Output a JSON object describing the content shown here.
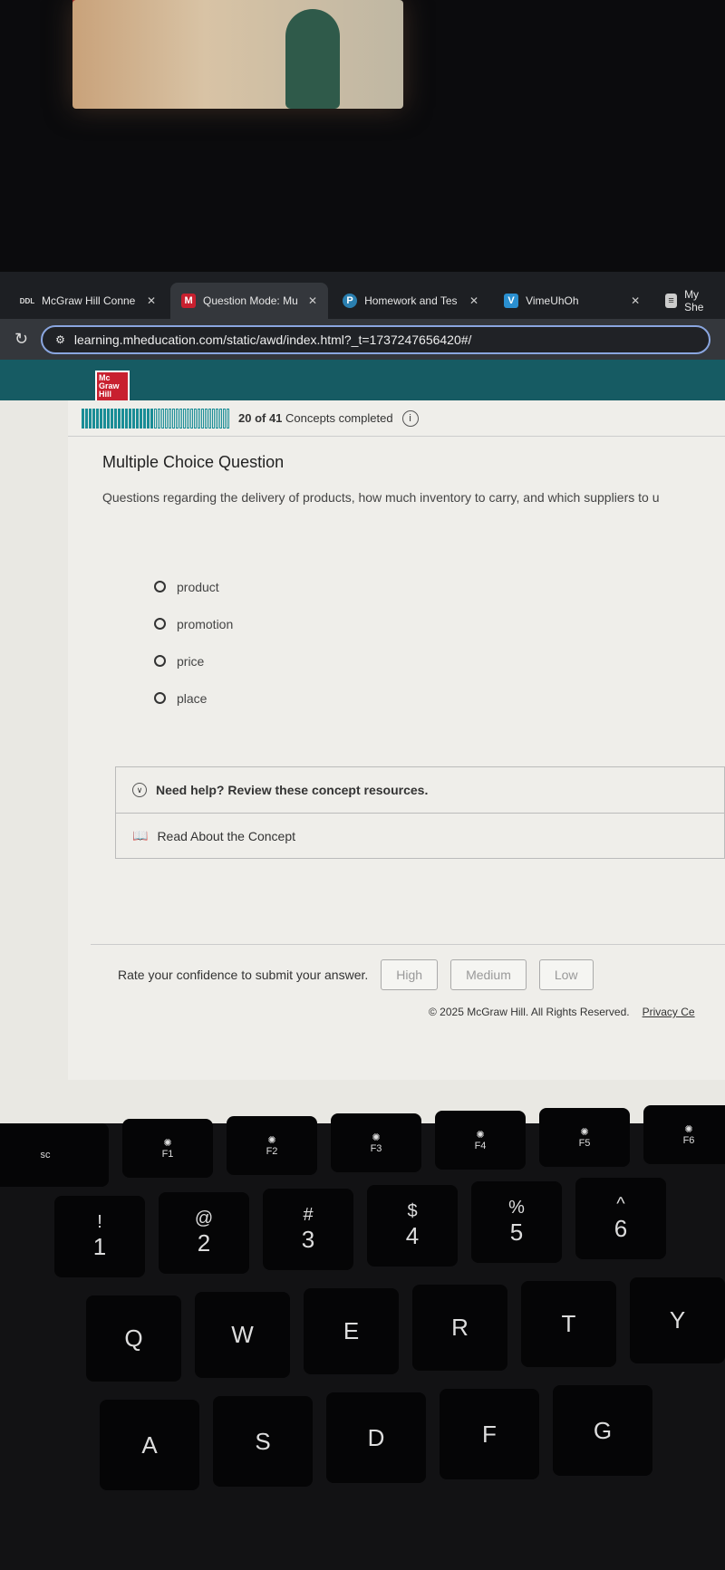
{
  "browser": {
    "tabs": [
      {
        "label": "McGraw Hill Conne",
        "icon": "ddl-icon"
      },
      {
        "label": "Question Mode: Mu",
        "icon": "mcgraw-m-icon",
        "active": true
      },
      {
        "label": "Homework and Tes",
        "icon": "p-icon"
      },
      {
        "label": "VimeUhOh",
        "icon": "vimeo-icon"
      },
      {
        "label": "My She",
        "icon": "doc-icon"
      }
    ],
    "url": "learning.mheducation.com/static/awd/index.html?_t=1737247656420#/"
  },
  "logo_text": "Mc Graw Hill",
  "progress": {
    "completed": 20,
    "total": 41,
    "count_label": "20 of 41",
    "label": "Concepts completed"
  },
  "question": {
    "type_label": "Multiple Choice Question",
    "text": "Questions regarding the delivery of products, how much inventory to carry, and which suppliers to u",
    "options": [
      "product",
      "promotion",
      "price",
      "place"
    ]
  },
  "help": {
    "title": "Need help? Review these concept resources.",
    "link": "Read About the Concept"
  },
  "confidence": {
    "prompt": "Rate your confidence to submit your answer.",
    "buttons": [
      "High",
      "Medium",
      "Low"
    ]
  },
  "footer": {
    "copyright": "© 2025 McGraw Hill. All Rights Reserved.",
    "privacy": "Privacy Ce"
  },
  "keyboard": {
    "fkeys": [
      "F1",
      "F2",
      "F3",
      "F4",
      "F5",
      "F6"
    ],
    "numbers": [
      {
        "sym": "!",
        "num": "1"
      },
      {
        "sym": "@",
        "num": "2"
      },
      {
        "sym": "#",
        "num": "3"
      },
      {
        "sym": "$",
        "num": "4"
      },
      {
        "sym": "%",
        "num": "5"
      },
      {
        "sym": "^",
        "num": "6"
      }
    ],
    "row_q": [
      "Q",
      "W",
      "E",
      "R",
      "T",
      "Y"
    ],
    "row_a": [
      "A",
      "S",
      "D",
      "F",
      "G"
    ],
    "esc": "sc"
  }
}
